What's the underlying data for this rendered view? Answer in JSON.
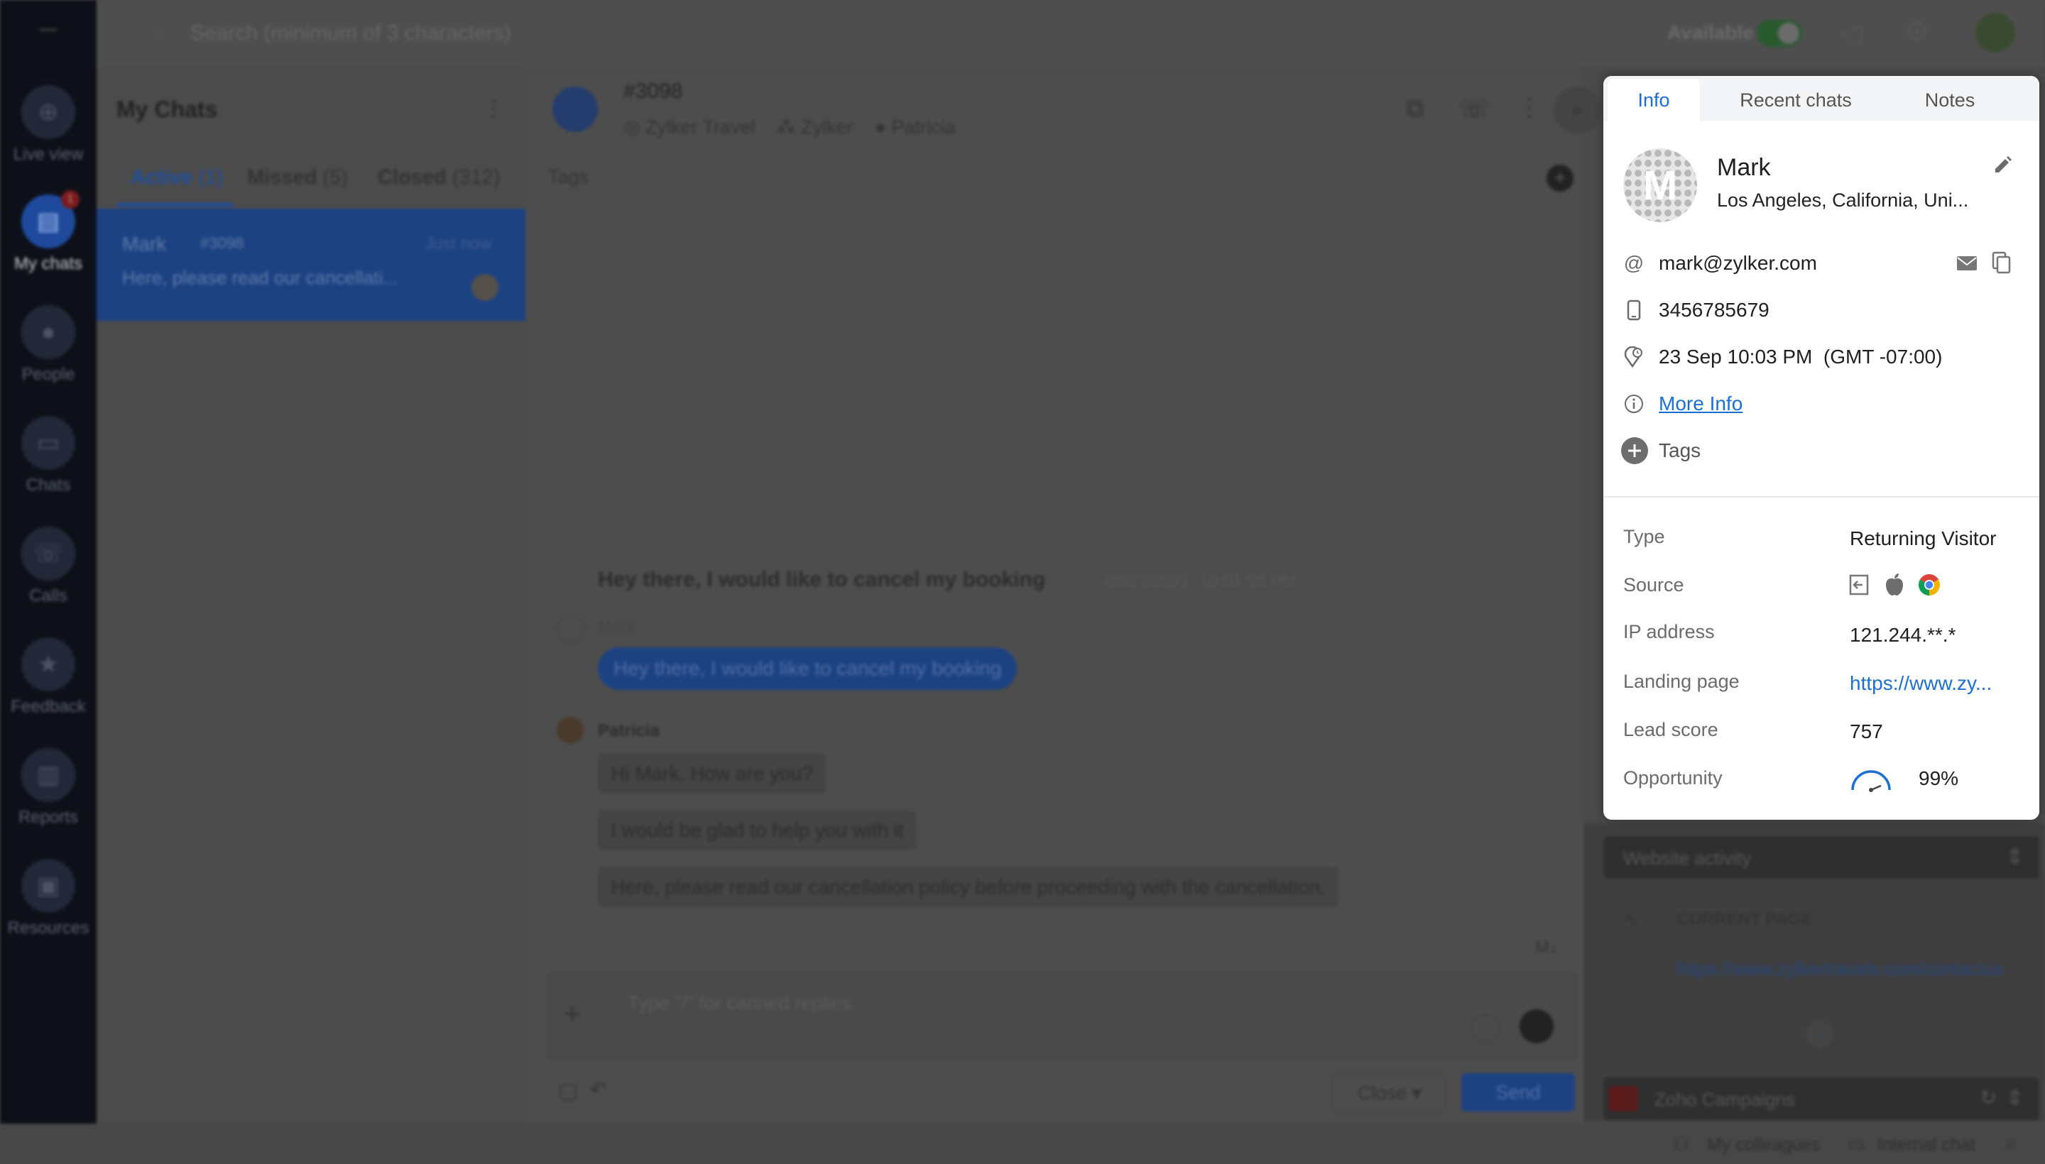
{
  "background": {
    "search_placeholder": "Search (minimum of 3 characters)",
    "availability": "Available",
    "nav": [
      {
        "label": "Live view",
        "icon": "target-icon"
      },
      {
        "label": "My chats",
        "icon": "chat-bubble-icon",
        "badge": "1"
      },
      {
        "label": "People",
        "icon": "person-icon"
      },
      {
        "label": "Chats",
        "icon": "chats-icon"
      },
      {
        "label": "Calls",
        "icon": "phone-icon"
      },
      {
        "label": "Feedback",
        "icon": "star-icon"
      },
      {
        "label": "Reports",
        "icon": "bar-chart-icon"
      },
      {
        "label": "Resources",
        "icon": "briefcase-icon"
      }
    ],
    "chat_list": {
      "title": "My Chats",
      "tabs": [
        {
          "label": "Active",
          "count": "(1)"
        },
        {
          "label": "Missed",
          "count": "(5)"
        },
        {
          "label": "Closed",
          "count": "(312)"
        }
      ],
      "item": {
        "name": "Mark",
        "id": "#3098",
        "time": "Just now",
        "preview": "Here, please read our cancellati..."
      }
    },
    "conversation": {
      "id": "#3098",
      "brand": "Zylker Travel",
      "department": "Zylker",
      "agent": "Patricia",
      "tags_label": "Tags",
      "question": "Hey there, I would like to cancel my booking",
      "question_time": "09/23/2021, 10:01:56 PM",
      "visitor_name": "Mark",
      "visitor_msg": "Hey there, I would like to cancel my booking",
      "agent_name": "Patricia",
      "agent_msgs": [
        "Hi Mark, How are you?",
        "I would be glad to help you with it",
        "Here, please read our cancellation policy before proceeding with the cancellation."
      ],
      "md_label": "M↓",
      "input_placeholder": "Type \"/\" for canned replies.",
      "close_label": "Close",
      "send_label": "Send"
    },
    "website_activity": {
      "title": "Website activity",
      "current_page_label": "CURRENT PAGE",
      "current_page_url": "https://www.zylkertravels.com/contactus"
    },
    "campaigns_title": "Zoho Campaigns",
    "footer": {
      "colleagues": "My colleagues",
      "internal_chat": "Internal chat"
    }
  },
  "panel": {
    "tabs": [
      "Info",
      "Recent chats",
      "Notes"
    ],
    "selected_tab": "Info",
    "visitor": {
      "name": "Mark",
      "location": "Los Angeles, California, Uni...",
      "avatar_letter": "M"
    },
    "email": "mark@zylker.com",
    "phone": "3456785679",
    "visit_time": "23 Sep 10:03 PM  (GMT -07:00)",
    "more_info": "More Info",
    "tags": "Tags",
    "properties": {
      "type_label": "Type",
      "type_value": "Returning Visitor",
      "source_label": "Source",
      "ip_label": "IP address",
      "ip_value": "121.244.**.*",
      "landing_label": "Landing page",
      "landing_value": "https://www.zy...",
      "lead_label": "Lead score",
      "lead_value": "757",
      "opportunity_label": "Opportunity",
      "opportunity_value": "99%"
    }
  },
  "colors": {
    "accent": "#1a6fd6",
    "nav_bg": "#0d1018",
    "overlay": "#4a4a4a",
    "available_green": "#2e9e3b"
  }
}
